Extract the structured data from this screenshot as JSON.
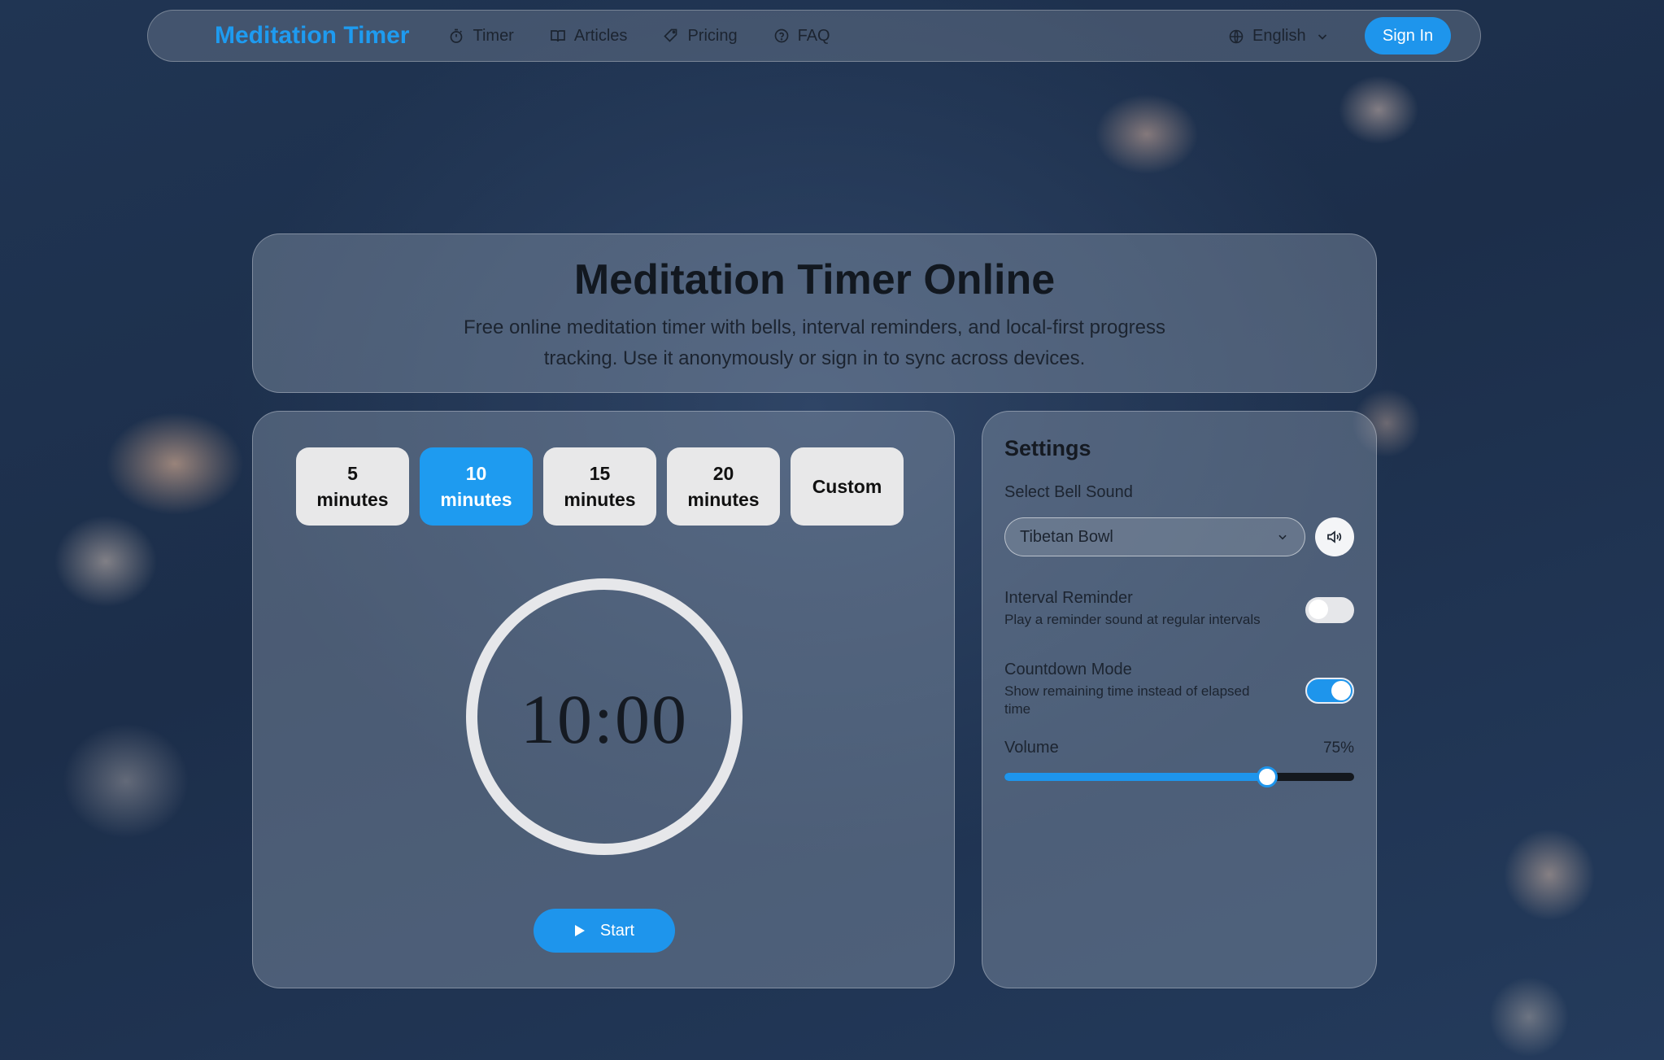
{
  "nav": {
    "brand": "Meditation Timer",
    "links": [
      {
        "label": "Timer",
        "icon": "stopwatch-icon"
      },
      {
        "label": "Articles",
        "icon": "book-icon"
      },
      {
        "label": "Pricing",
        "icon": "tag-icon"
      },
      {
        "label": "FAQ",
        "icon": "help-circle-icon"
      }
    ],
    "language": "English",
    "sign_in": "Sign In"
  },
  "hero": {
    "title": "Meditation Timer Online",
    "description": "Free online meditation timer with bells, interval reminders, and local-first progress tracking. Use it anonymously or sign in to sync across devices."
  },
  "timer": {
    "durations": [
      {
        "num": "5",
        "unit": "minutes",
        "active": false
      },
      {
        "num": "10",
        "unit": "minutes",
        "active": true
      },
      {
        "num": "15",
        "unit": "minutes",
        "active": false
      },
      {
        "num": "20",
        "unit": "minutes",
        "active": false
      },
      {
        "num": "Custom",
        "unit": "",
        "active": false
      }
    ],
    "display": "10:00",
    "start_label": "Start"
  },
  "settings": {
    "title": "Settings",
    "bell_label": "Select Bell Sound",
    "bell_value": "Tibetan Bowl",
    "interval_label": "Interval Reminder",
    "interval_desc": "Play a reminder sound at regular intervals",
    "interval_on": false,
    "countdown_label": "Countdown Mode",
    "countdown_desc": "Show remaining time instead of elapsed time",
    "countdown_on": true,
    "volume_label": "Volume",
    "volume_value": "75%",
    "volume_fraction": 0.75
  },
  "colors": {
    "accent": "#1e95ec",
    "brand": "#1e9bf0"
  }
}
